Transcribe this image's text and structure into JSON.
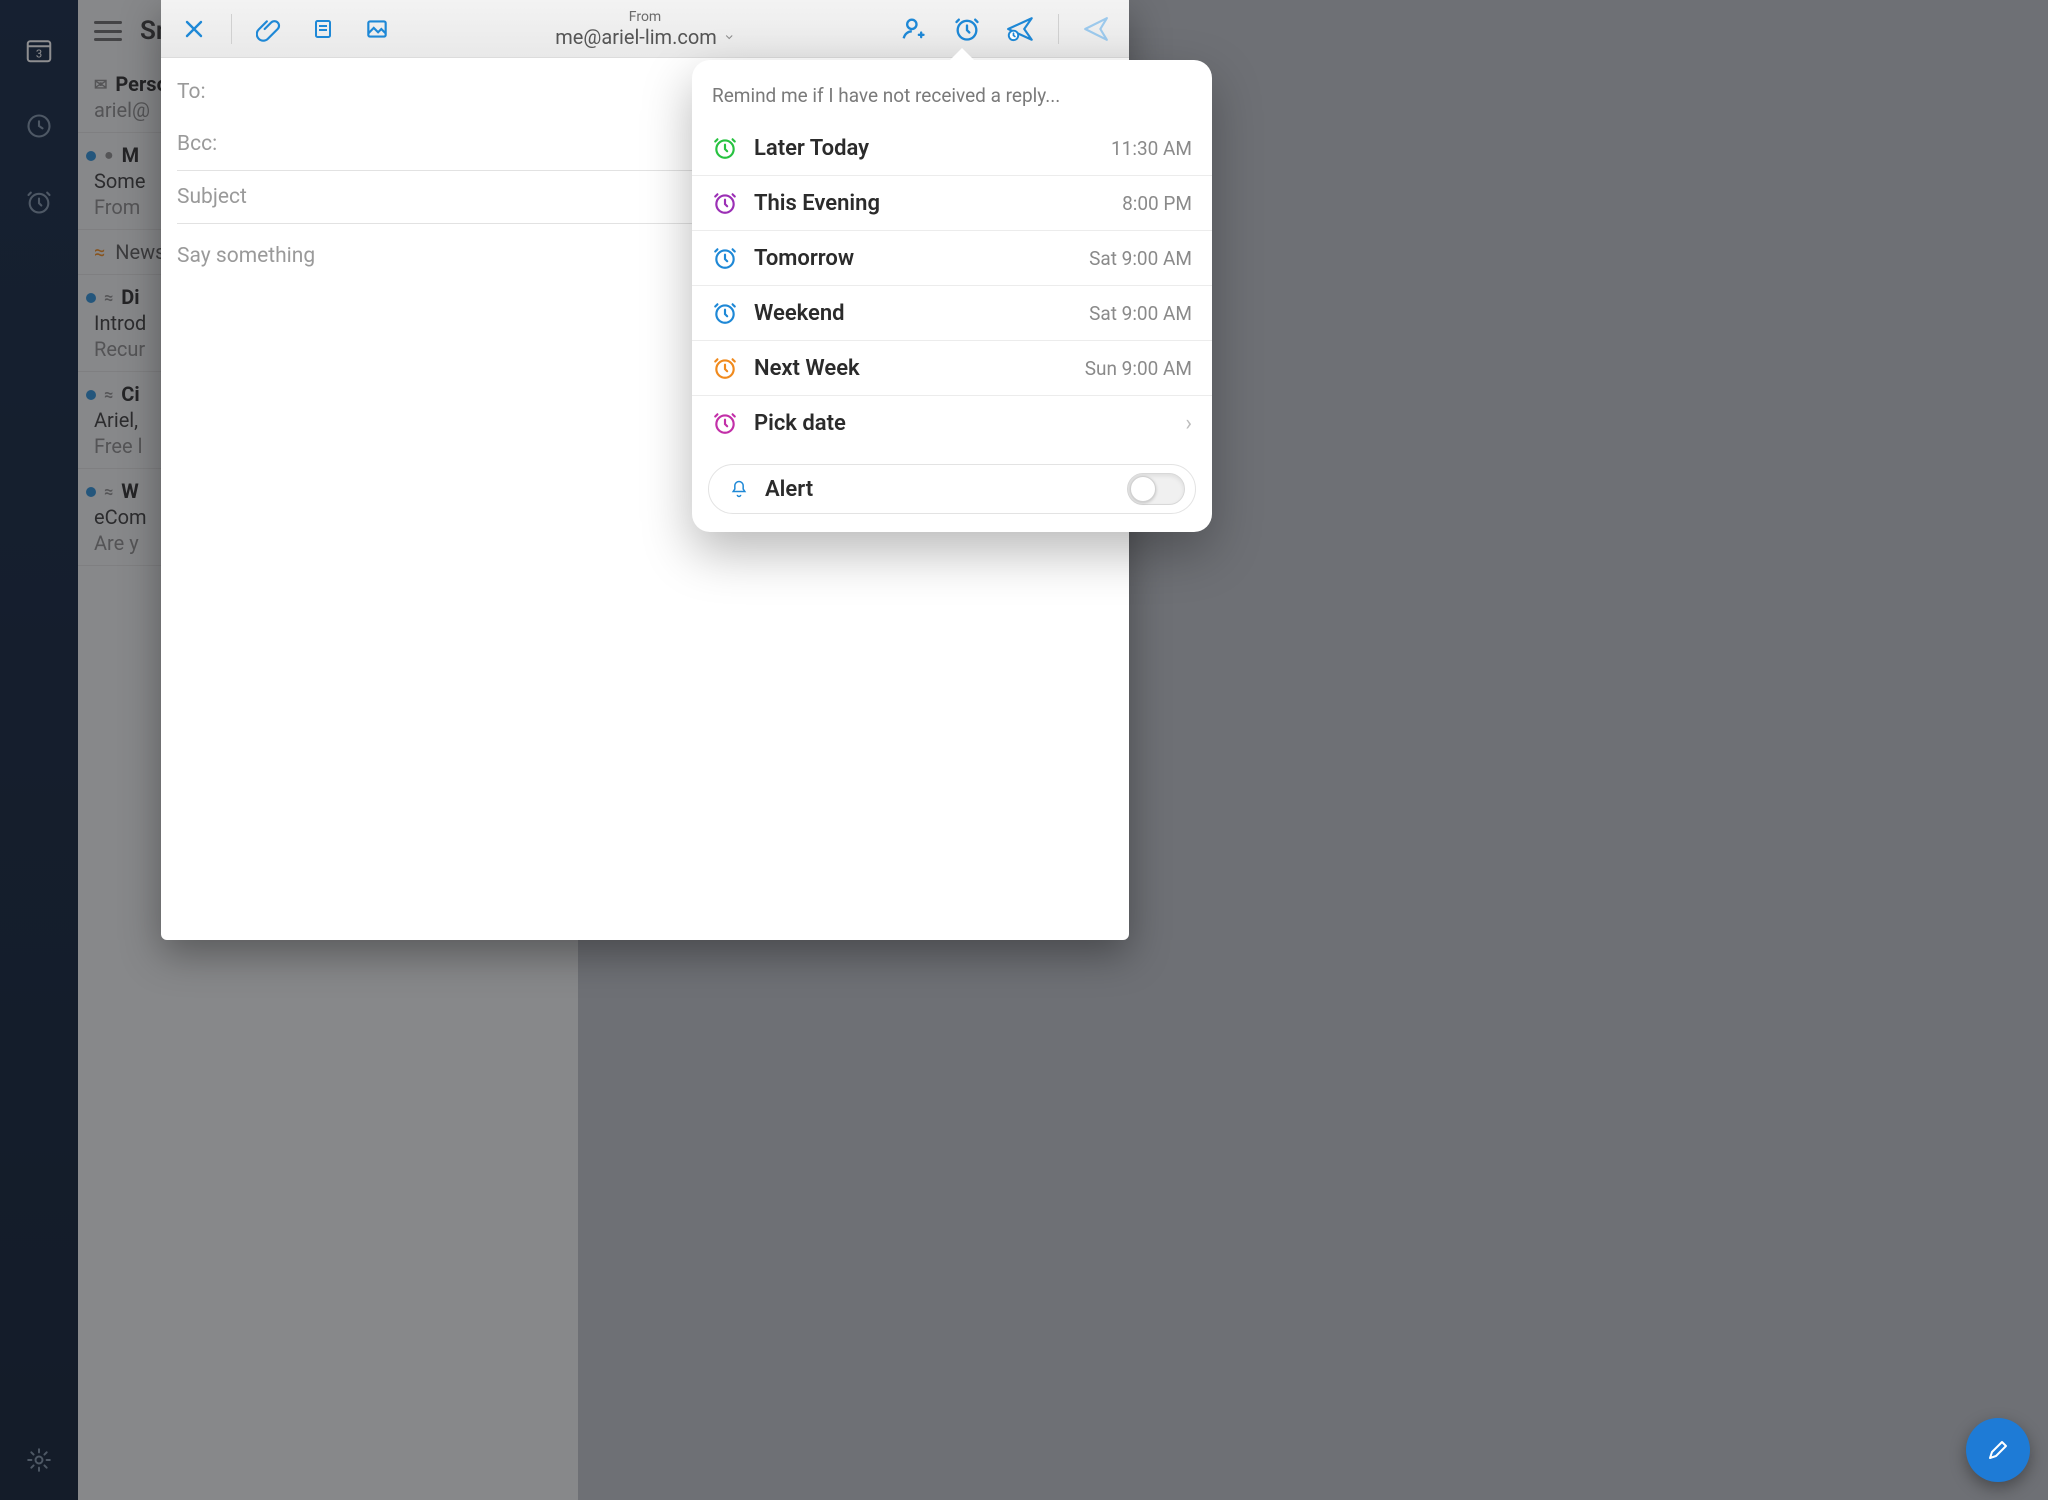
{
  "rail": {
    "calendar_day": "3"
  },
  "maillist": {
    "title": "Sm",
    "items": [
      {
        "sender": "Person",
        "line2": "ariel@",
        "icon": "mail"
      },
      {
        "sender": "M",
        "line2": "Some",
        "line3": "From",
        "unread": true,
        "icon": "person"
      }
    ],
    "section_label": "Newsl",
    "feed_items": [
      {
        "sender": "Di",
        "line2": "Introd",
        "line3": "Recur",
        "unread": true
      },
      {
        "sender": "Ci",
        "line2": "Ariel,",
        "line3": "Free l",
        "unread": true
      },
      {
        "sender": "W",
        "line2": "eCom",
        "line3": "Are y",
        "unread": true
      }
    ]
  },
  "compose": {
    "from_label": "From",
    "from_address": "me@ariel-lim.com",
    "to_label": "To:",
    "bcc_label": "Bcc:",
    "subject_placeholder": "Subject",
    "body_placeholder": "Say something"
  },
  "reminder": {
    "header": "Remind me if I have not received a reply...",
    "options": [
      {
        "label": "Later Today",
        "time": "11:30 AM",
        "color": "#27c240"
      },
      {
        "label": "This Evening",
        "time": "8:00 PM",
        "color": "#9b2fb5"
      },
      {
        "label": "Tomorrow",
        "time": "Sat 9:00 AM",
        "color": "#1e88d6"
      },
      {
        "label": "Weekend",
        "time": "Sat 9:00 AM",
        "color": "#1e88d6"
      },
      {
        "label": "Next Week",
        "time": "Sun 9:00 AM",
        "color": "#f08a1d"
      }
    ],
    "pick_date_label": "Pick date",
    "pick_date_color": "#c22fa8",
    "alert_label": "Alert",
    "alert_on": false
  }
}
